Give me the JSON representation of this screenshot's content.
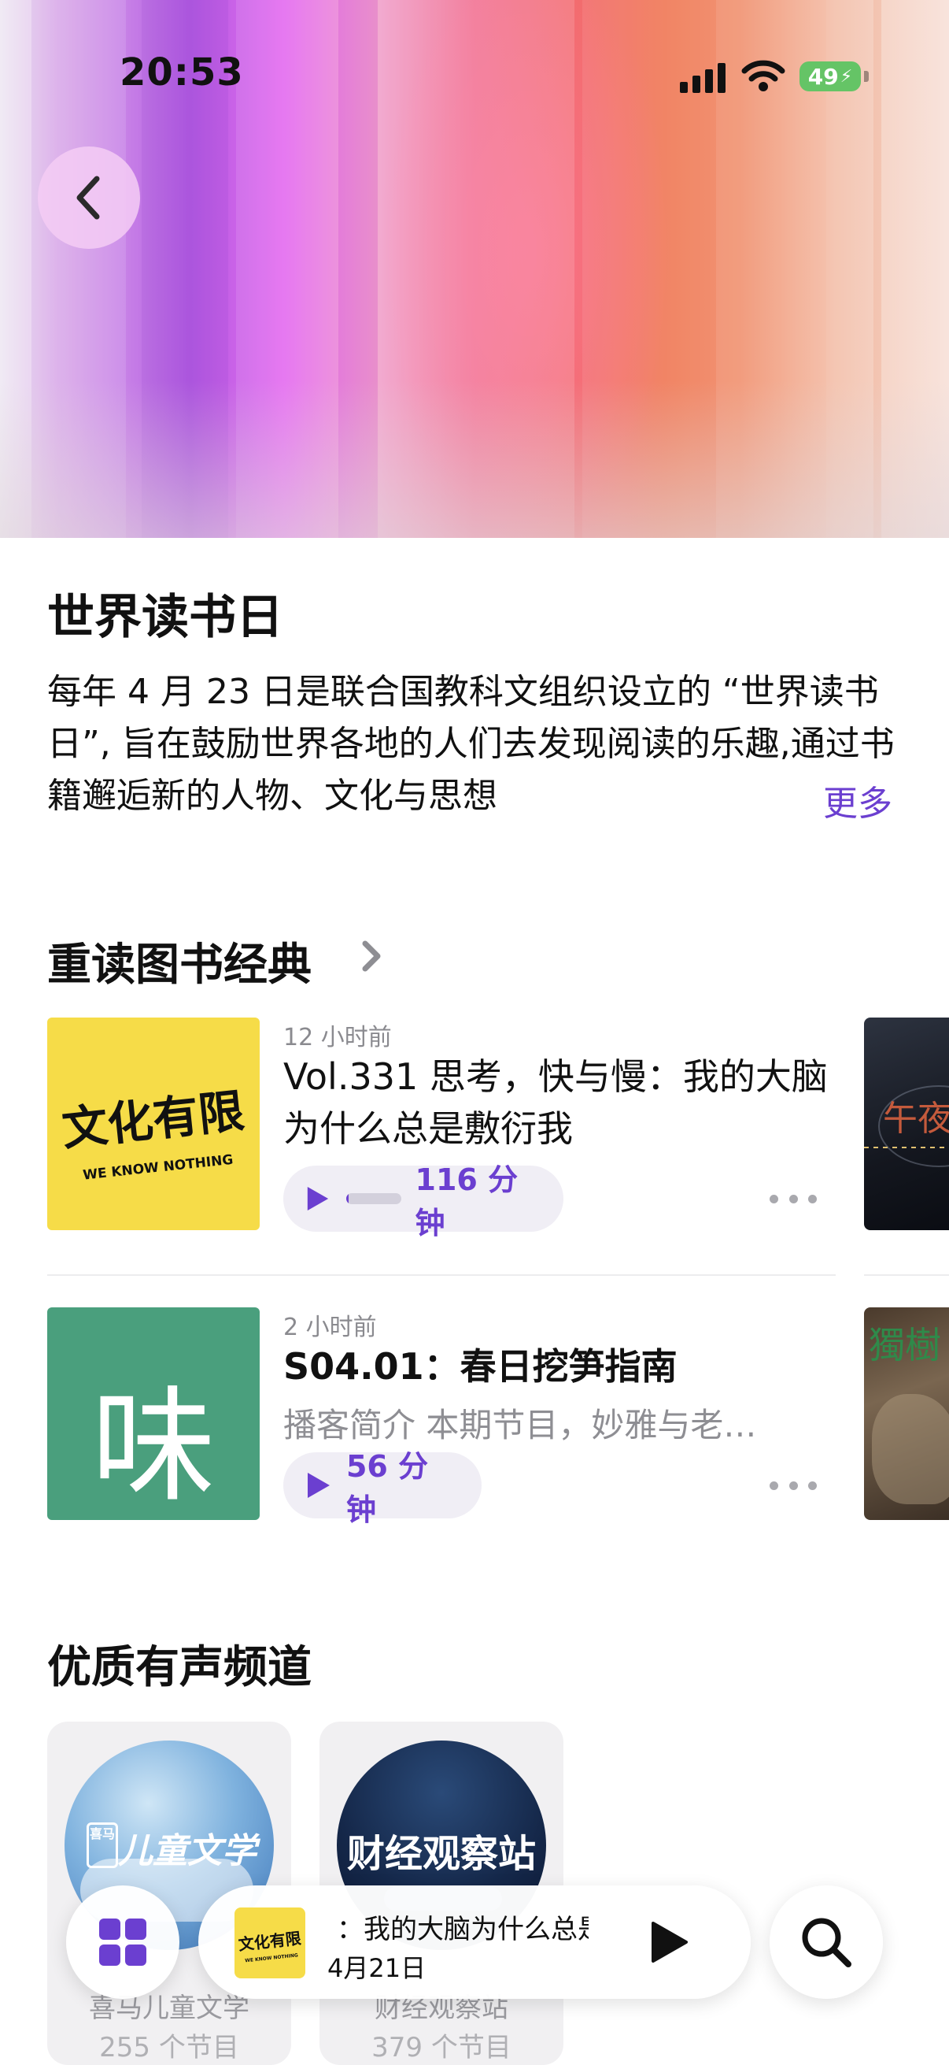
{
  "status_bar": {
    "time": "20:53",
    "battery": "49"
  },
  "intro": {
    "title": "世界读书日",
    "description": "每年 4 月 23 日是联合国教科文组织设立的 “世界读书日”, 旨在鼓励世界各地的人们去发现阅读的乐趣,通过书籍邂逅新的人物、文化与思想",
    "more_label": "更多"
  },
  "classics": {
    "title": "重读图书经典",
    "episodes": [
      {
        "meta": "12 小时前",
        "title": "Vol.331 思考，快与慢：我的大脑为什么总是敷衍我",
        "duration": "116 分钟",
        "progress": 0.05,
        "cover_logo": "文化有限",
        "cover_tagline": "WE KNOW NOTHING"
      },
      {
        "meta": "2 小时前",
        "title": "S04.01：春日挖笋指南",
        "summary": "播客简介 本期节目，妙雅与老…",
        "duration": "56 分钟",
        "cover_char": "味"
      }
    ],
    "side_cards": [
      {
        "glyph": "午夜"
      },
      {
        "glyph": "獨樹"
      }
    ]
  },
  "channels": {
    "title": "优质有声频道",
    "items": [
      {
        "logo": "喜马",
        "logo_text": "儿童文学",
        "name": "喜马儿童文学",
        "count": "255 个节目"
      },
      {
        "logo_text": "财经观察站",
        "name": "财经观察站",
        "count": "379 个节目"
      }
    ]
  },
  "mini_player": {
    "title": "：我的大脑为什么总是",
    "date": "4月21日",
    "cover_logo": "文化有限",
    "cover_tagline": "WE KNOW NOTHING"
  },
  "colors": {
    "accent": "#6b3fd0",
    "cover_yellow": "#f6dc48",
    "cover_green": "#4a9f7d"
  }
}
